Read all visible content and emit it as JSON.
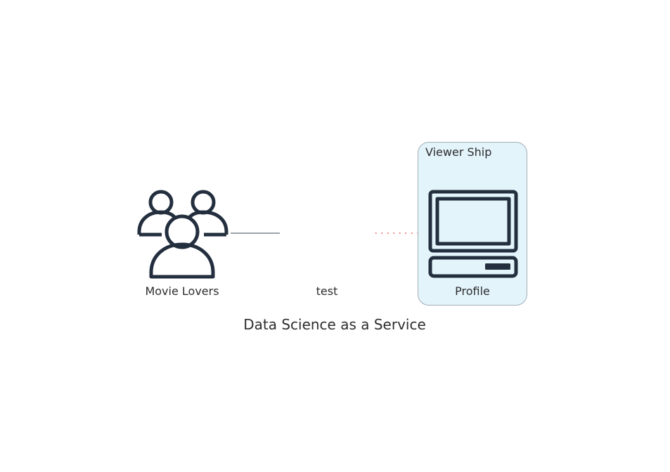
{
  "diagram": {
    "title": "Data Science as a Service",
    "nodes": {
      "movie_lovers": {
        "label": "Movie Lovers",
        "icon": "users-icon"
      },
      "test": {
        "label": "test",
        "icon": ""
      },
      "profile": {
        "label": "Profile",
        "icon": "computer-icon"
      }
    },
    "cluster": {
      "label": "Viewer Ship"
    },
    "edges": [
      {
        "from": "movie_lovers",
        "to": "test",
        "style": "solid",
        "color": "#7a8793"
      },
      {
        "from": "test",
        "to": "profile",
        "style": "dotted",
        "color": "#e03c31"
      }
    ],
    "colors": {
      "icon": "#232f3e",
      "cluster_fill": "#e3f4fb",
      "cluster_border": "#a2aeb8"
    }
  }
}
